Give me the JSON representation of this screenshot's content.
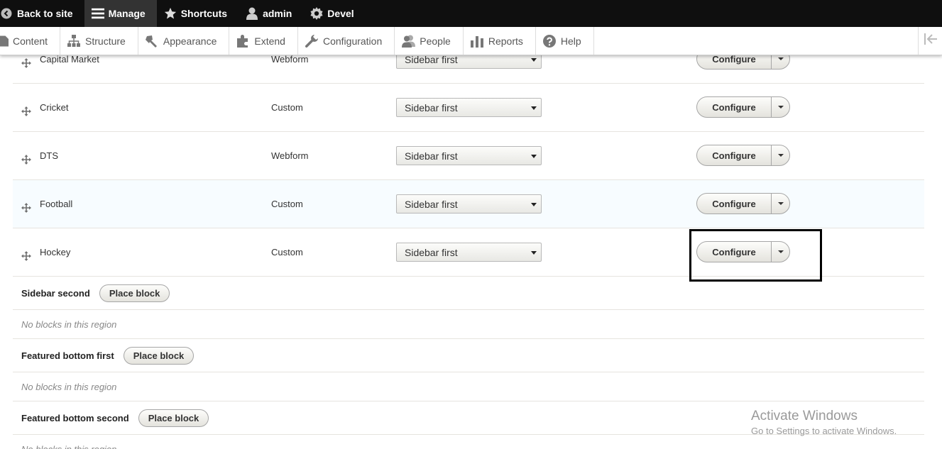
{
  "toolbar": {
    "back_to_site": "Back to site",
    "manage": "Manage",
    "shortcuts": "Shortcuts",
    "user": "admin",
    "devel": "Devel"
  },
  "tray": {
    "items": [
      {
        "label": "Content",
        "icon": "file-icon"
      },
      {
        "label": "Structure",
        "icon": "structure-icon"
      },
      {
        "label": "Appearance",
        "icon": "paintbrush-icon"
      },
      {
        "label": "Extend",
        "icon": "puzzle-icon"
      },
      {
        "label": "Configuration",
        "icon": "wrench-icon"
      },
      {
        "label": "People",
        "icon": "people-icon"
      },
      {
        "label": "Reports",
        "icon": "bar-chart-icon"
      },
      {
        "label": "Help",
        "icon": "help-icon"
      }
    ]
  },
  "blocks": [
    {
      "name": "Capital Market",
      "category": "Webform",
      "region": "Sidebar first",
      "action": "Configure"
    },
    {
      "name": "Cricket",
      "category": "Custom",
      "region": "Sidebar first",
      "action": "Configure"
    },
    {
      "name": "DTS",
      "category": "Webform",
      "region": "Sidebar first",
      "action": "Configure"
    },
    {
      "name": "Football",
      "category": "Custom",
      "region": "Sidebar first",
      "action": "Configure"
    },
    {
      "name": "Hockey",
      "category": "Custom",
      "region": "Sidebar first",
      "action": "Configure"
    }
  ],
  "regions": [
    {
      "title": "Sidebar second",
      "button": "Place block",
      "empty": "No blocks in this region"
    },
    {
      "title": "Featured bottom first",
      "button": "Place block",
      "empty": "No blocks in this region"
    },
    {
      "title": "Featured bottom second",
      "button": "Place block",
      "empty": "No blocks in this region"
    }
  ],
  "watermark": {
    "title": "Activate Windows",
    "subtitle": "Go to Settings to activate Windows."
  },
  "colors": {
    "toolbar_bg": "#0f0f0f",
    "highlight_row": "#f7fcff",
    "highlight_box": "#000000"
  }
}
